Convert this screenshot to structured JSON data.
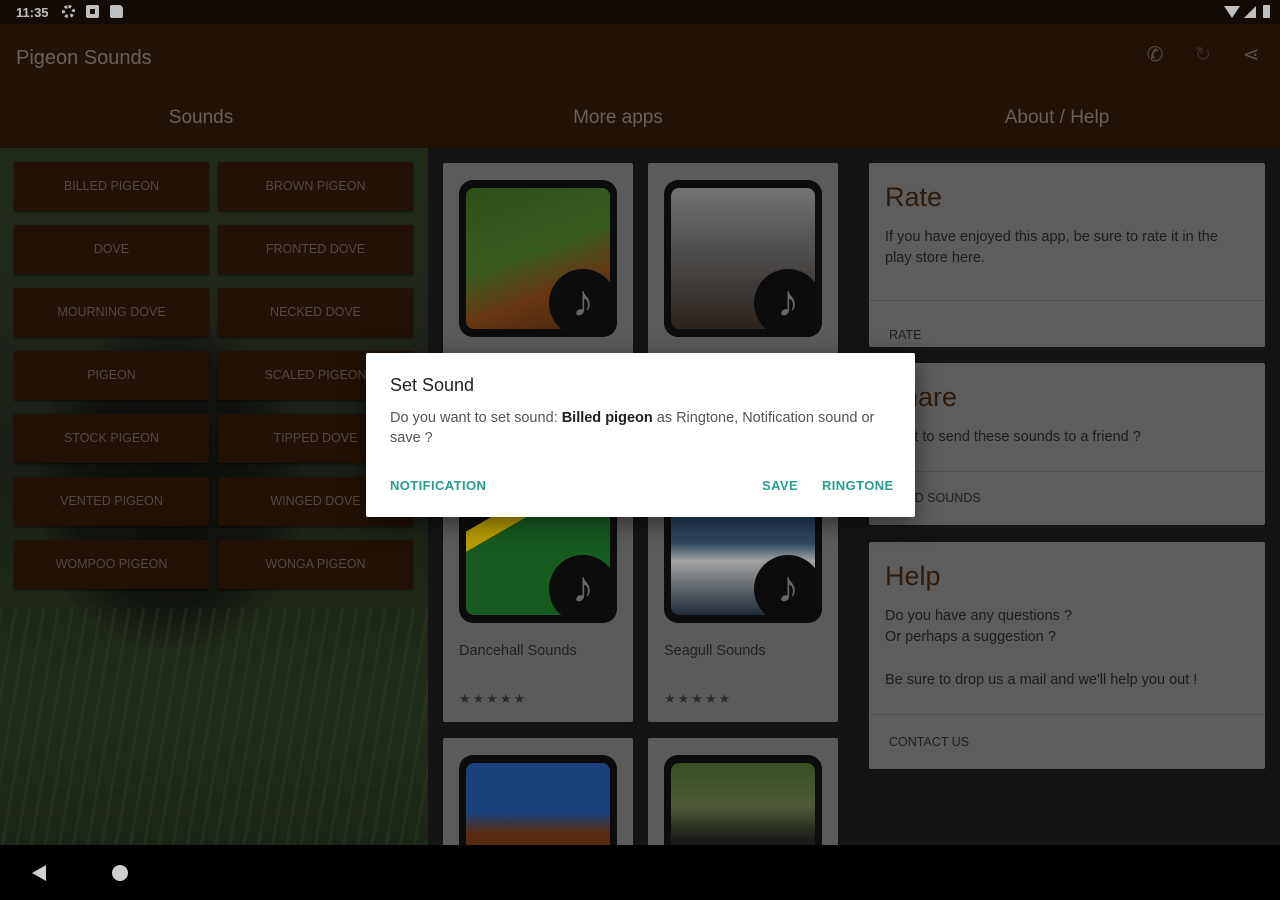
{
  "status": {
    "time": "11:35"
  },
  "app": {
    "title": "Pigeon Sounds",
    "tabs": [
      "Sounds",
      "More apps",
      "About / Help"
    ]
  },
  "sounds": [
    "BILLED PIGEON",
    "BROWN PIGEON",
    "DOVE",
    "FRONTED DOVE",
    "MOURNING DOVE",
    "NECKED DOVE",
    "PIGEON",
    "SCALED PIGEON",
    "STOCK PIGEON",
    "TIPPED DOVE",
    "VENTED PIGEON",
    "WINGED DOVE",
    "WOMPOO PIGEON",
    "WONGA PIGEON"
  ],
  "apps": [
    {
      "name": "",
      "colors": [
        "#3d6b22",
        "#8a4a1c"
      ],
      "stars": ""
    },
    {
      "name": "",
      "colors": [
        "#6e6e6e",
        "#3b2f27"
      ],
      "stars": ""
    },
    {
      "name": "Dancehall Sounds",
      "colors": [
        "#1f7a2a",
        "#f5d000"
      ],
      "stars": "★★★★★"
    },
    {
      "name": "Seagull Sounds",
      "colors": [
        "#2a4a6a",
        "#d8d8d8"
      ],
      "stars": "★★★★★"
    },
    {
      "name": "",
      "colors": [
        "#2457a8",
        "#7a3a18"
      ],
      "stars": ""
    },
    {
      "name": "",
      "colors": [
        "#4c6a2c",
        "#222"
      ],
      "stars": ""
    }
  ],
  "side": {
    "rate": {
      "title": "Rate",
      "text": "If you have enjoyed this app, be sure to rate it in the play store here.",
      "action": "RATE"
    },
    "share": {
      "title": "Share",
      "text": "Want to send these sounds to a friend ?",
      "action": "SEND SOUNDS"
    },
    "help": {
      "title": "Help",
      "line1": "Do you have any questions ?",
      "line2": "Or perhaps a suggestion ?",
      "line3": "Be sure to drop us a mail and we'll help you out !",
      "action": "CONTACT US"
    }
  },
  "dialog": {
    "title": "Set Sound",
    "msg_prefix": "Do you want to set sound: ",
    "sound_name": "Billed pigeon",
    "msg_suffix": " as Ringtone, Notification sound or save ?",
    "btn_notification": "NOTIFICATION",
    "btn_save": "SAVE",
    "btn_ringtone": "RINGTONE"
  },
  "colors": {
    "toolbar": "#2c180b",
    "accent": "#2a9d8f",
    "sound_button": "#2d1708"
  }
}
